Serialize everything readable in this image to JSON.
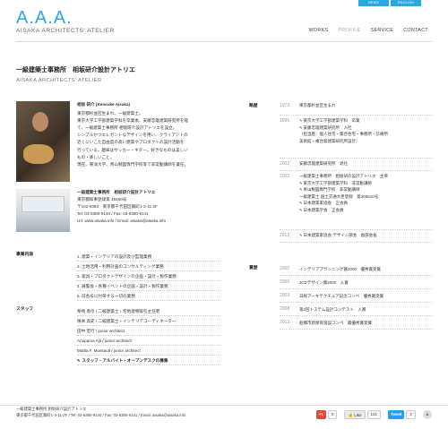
{
  "top_buttons": [
    "NEWS",
    "ENGLISH"
  ],
  "brand": {
    "logo": "A.A.A.",
    "subtitle": "AISAKA ARCHITECTS' ATELIER",
    "accent": "#2aa8e0"
  },
  "nav": [
    {
      "label": "WORKS",
      "active": false
    },
    {
      "label": "PROFILE",
      "active": true
    },
    {
      "label": "SERVICE",
      "active": false
    },
    {
      "label": "CONTACT",
      "active": false
    }
  ],
  "header": {
    "title": "一級建築士事務所　相坂研介設計アトリエ",
    "subtitle": "AISAKA ARCHITECTS' ATELIER"
  },
  "profile": {
    "name": "相坂 研介 (Kensuke Aisaka)",
    "lines": [
      "東京都杉並区生まれ、一級建築士。",
      "東京大学工学部建築学科を卒業後、安藤忠雄建築研究所を経",
      "て、一級建築士事務所 相坂研介設計アトリエを設立。",
      "シンプルかつエレガントなデザインを用い、クライアントの",
      "近くにいこた自由度の高い建築やプロダクトの設計活動を",
      "行っている。趣味はサッカー・ギター。好きなものは美しい",
      "もの・楽しいこと。",
      "現在、東洋大学、青山製図専門学校等で非常勤講師を兼任。"
    ]
  },
  "office": {
    "name": "一級建築士事務所　相坂研介設計アトリエ",
    "lines": [
      "東京都知事登録第 48460号",
      "〒102-0083　東京都千代田区麹町1-3-11-2F",
      "Tel: 03-6380-9140 / Fax: 03-6380-9141",
      "Url: www.aisaka.info / Email: aisaka@aisaka.info"
    ]
  },
  "services": {
    "label": "事業内容",
    "items": [
      "1. 建築・インテリアの設計及び監理業務",
      "2. 土地活用・利用計画のコンサルティング業務",
      "3. 家具・プロダクトデザインの企画・設計・製作業務",
      "4. 展覧会・各種イベントの企画・設計・製作業務",
      "5. 前各号に付帯する一切の業務"
    ]
  },
  "staff": {
    "label": "スタッフ",
    "items": [
      "柴崎 香奈 / 二級建築士・宅地建物取引主任者",
      "塚本 高史 / 二級建築士・インテリアコーディネーター",
      "田中 宏行 / junior architect",
      "Anupama Ajit / junior architect",
      "Mattia F. Mussault / junior architect"
    ],
    "recruit": "スタッフ・アルバイト・オープンデスクの募集"
  },
  "history": {
    "label": "略歴",
    "rows": [
      {
        "year": "1973",
        "lines": [
          "東京都杉並区生まれ"
        ]
      },
      {
        "year": "1996",
        "lines": [
          "東京大学工学部建築学科　卒業",
          "安藤忠雄建築研究所　入社",
          "（担当歴：個人住宅・集合住宅・事務所・診療所",
          "美術館・複合発建築研究所設計）"
        ]
      },
      {
        "year": "2002",
        "lines": [
          "安藤忠雄建築研究所　退社"
        ]
      },
      {
        "year": "2003",
        "lines": [
          "一級建築士事務所　相坂研介設計アトリエ　主宰",
          "東京大学工学部建築学科　非常勤講師",
          "青山製図専門学校　非常勤講師",
          "一級建築士 国土交通大臣登録　第305610号",
          "日本建築家協会　正会員",
          "日本建築学会　正会員"
        ]
      },
      {
        "year": "2013",
        "lines": [
          "日本建築家協会 デザイン部会　副部会長"
        ]
      }
    ]
  },
  "awards": {
    "label": "賞歴",
    "rows": [
      {
        "year": "2000",
        "text": "インテリアプランニング賞2000　優秀賞受賞"
      },
      {
        "year": "2000",
        "text": "JCDデザイン賞2000　入賞"
      },
      {
        "year": "2003",
        "text": "日経アーキテクチュア記念コンペ　優秀賞受賞"
      },
      {
        "year": "2008",
        "text": "第2回トステム設計コンテスト　入賞"
      },
      {
        "year": "2013",
        "text": "船橋市新保育施設コンペ　最優秀賞受賞"
      }
    ]
  },
  "footer": {
    "line1": "一級建築士事務所 相坂研介設計アトリエ",
    "line2": "東京都千代田区麹町1-3-11-2F / Tel: 03-6380-9140 / Fax: 03-6380-9141 / Email: aisaka@aisaka.info"
  },
  "social": {
    "gplus_label": "+1",
    "gplus_count": "0",
    "like_label": "Like",
    "like_count": "141",
    "tweet_label": "Tweet",
    "tweet_count": "2"
  }
}
